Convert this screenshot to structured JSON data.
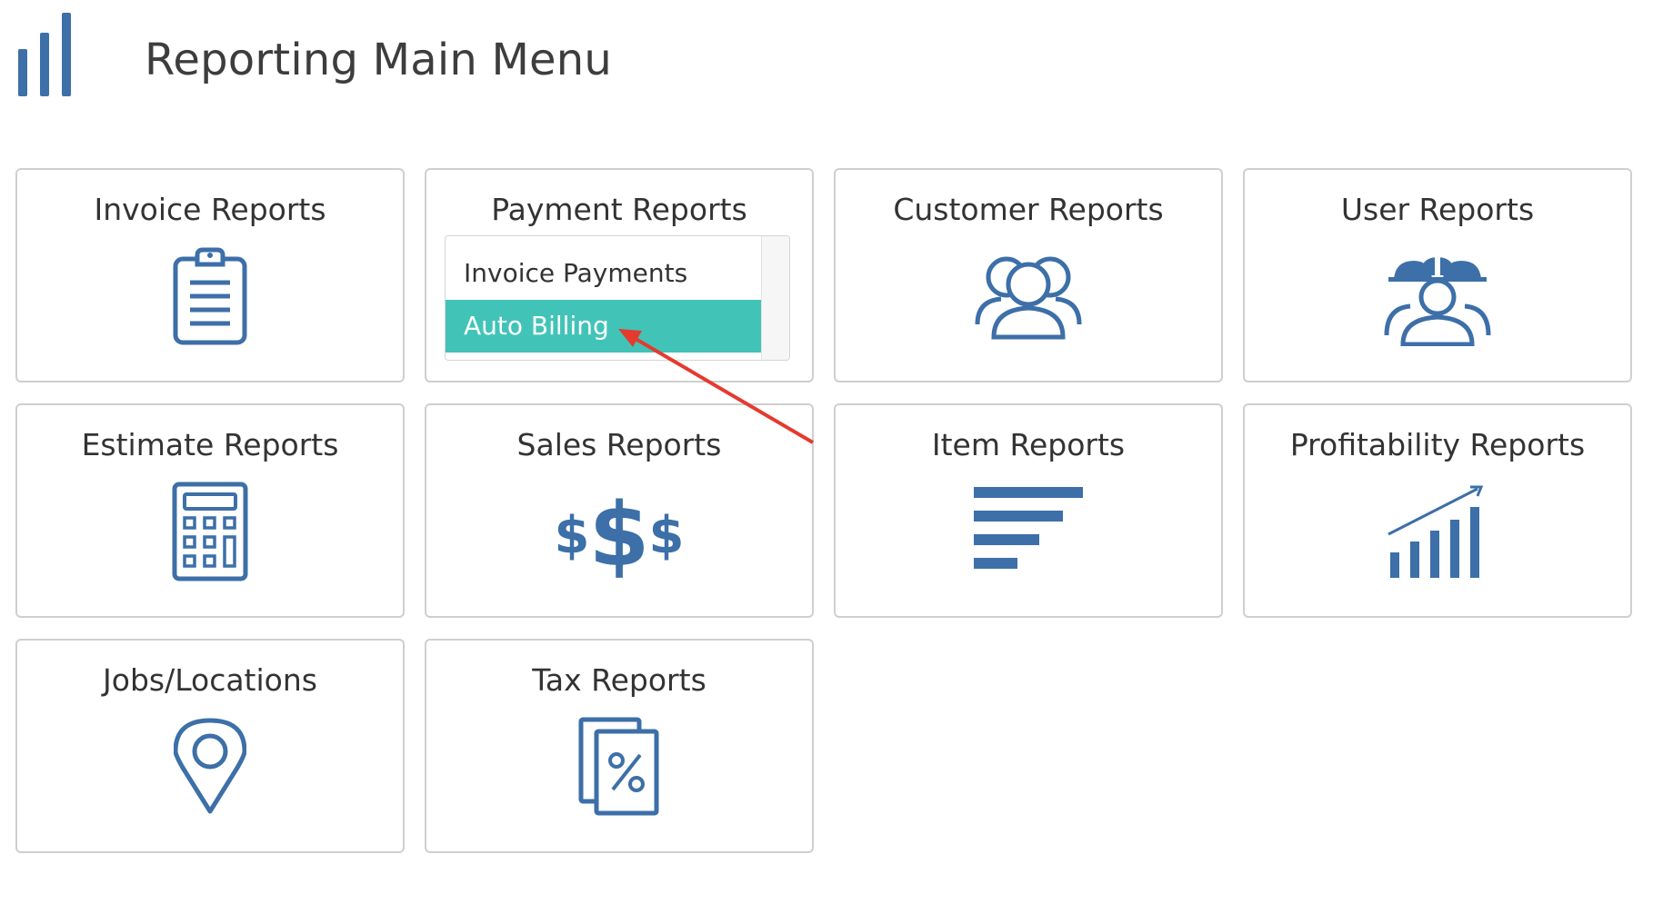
{
  "page": {
    "title": "Reporting Main Menu",
    "icon": "bar-chart-icon"
  },
  "accent_color": "#3d6fa8",
  "selection_color": "#41c4b7",
  "annotation_color": "#e53a2f",
  "cards": [
    {
      "title": "Invoice Reports",
      "icon": "clipboard-icon"
    },
    {
      "title": "Payment Reports",
      "icon": "payment-dropdown",
      "dropdown": {
        "items": [
          "Invoice Payments",
          "Auto Billing"
        ],
        "selected": "Auto Billing"
      }
    },
    {
      "title": "Customer Reports",
      "icon": "customers-icon"
    },
    {
      "title": "User Reports",
      "icon": "workers-icon"
    },
    {
      "title": "Estimate Reports",
      "icon": "calculator-icon"
    },
    {
      "title": "Sales Reports",
      "icon": "dollar-signs-icon"
    },
    {
      "title": "Item Reports",
      "icon": "list-bars-icon"
    },
    {
      "title": "Profitability Reports",
      "icon": "growth-chart-icon"
    },
    {
      "title": "Jobs/Locations",
      "icon": "map-pin-icon"
    },
    {
      "title": "Tax Reports",
      "icon": "tax-document-icon"
    }
  ]
}
